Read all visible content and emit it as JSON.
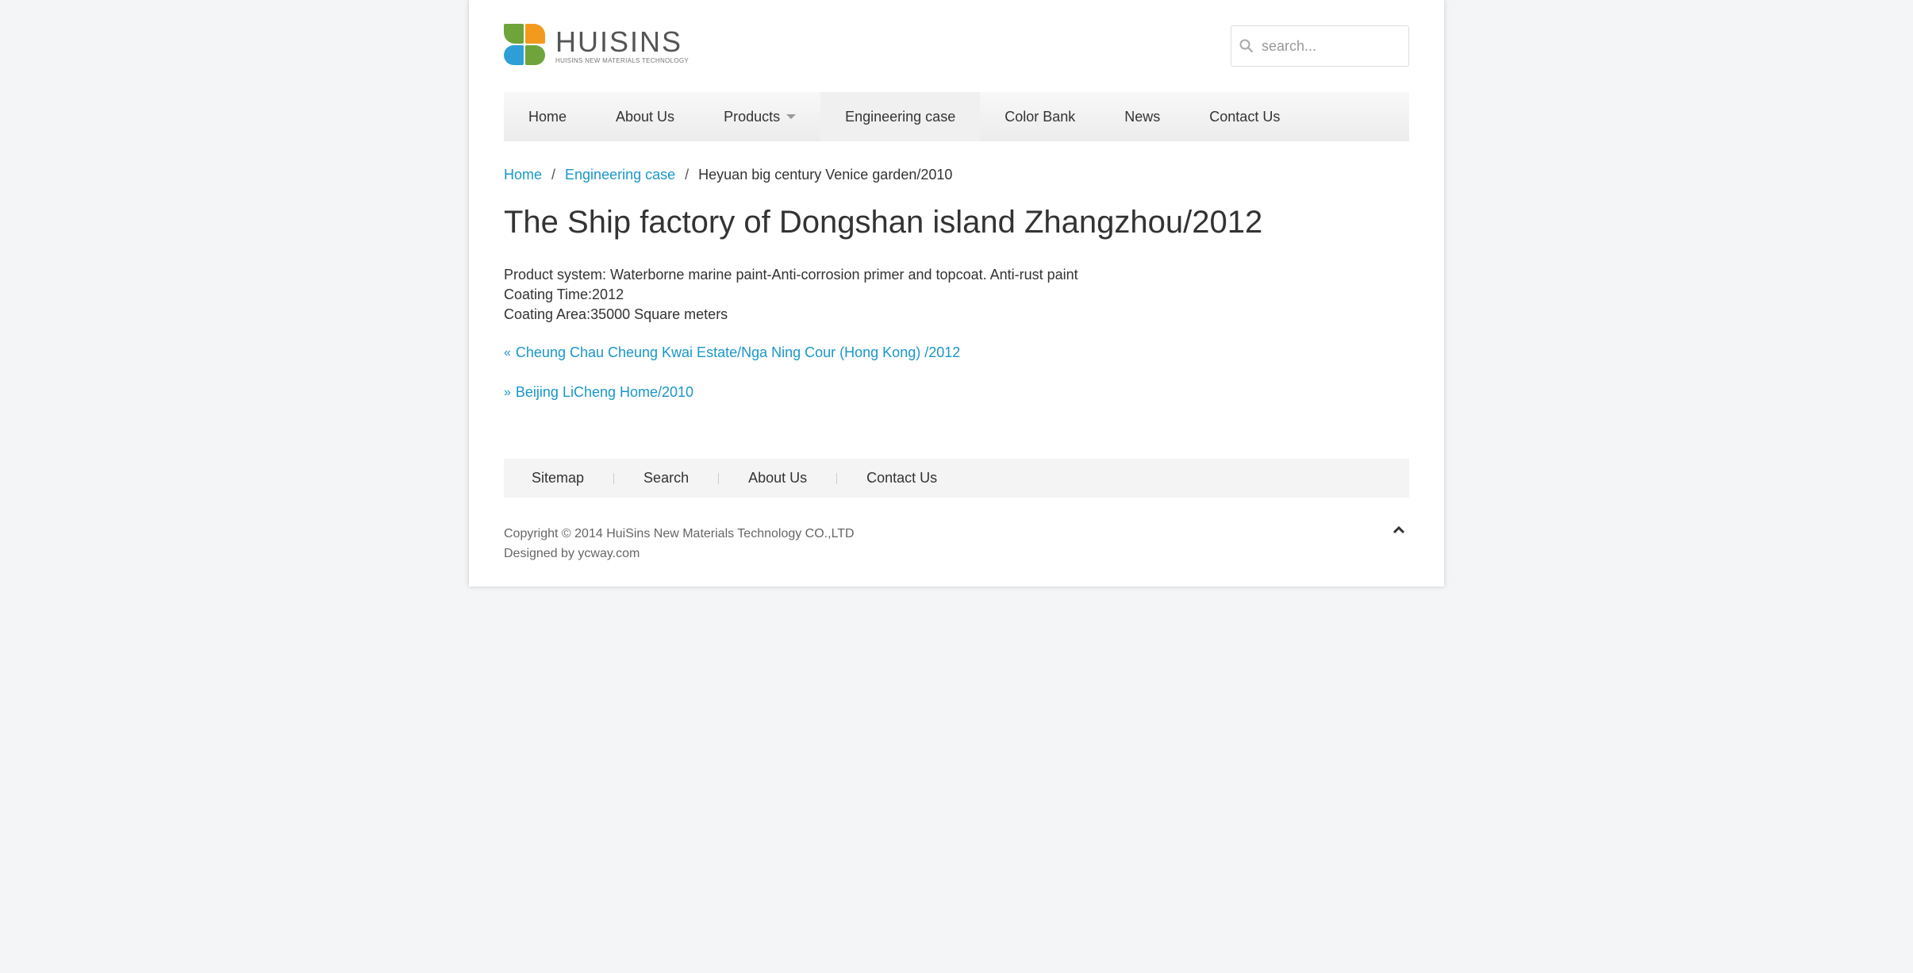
{
  "brand": {
    "name": "HUISINS",
    "tagline": "HUISINS NEW MATERIALS TECHNOLOGY",
    "colors": {
      "green": "#6ea43a",
      "orange": "#f39a1e",
      "blue": "#2d9fd6"
    }
  },
  "search": {
    "placeholder": "search...",
    "value": "",
    "icon": "search-icon"
  },
  "nav": {
    "items": [
      {
        "label": "Home"
      },
      {
        "label": "About Us"
      },
      {
        "label": "Products",
        "has_dropdown": true
      },
      {
        "label": "Engineering case",
        "active": true
      },
      {
        "label": "Color Bank"
      },
      {
        "label": "News"
      },
      {
        "label": "Contact Us"
      }
    ]
  },
  "breadcrumb": {
    "home": "Home",
    "sep1": "/",
    "section": "Engineering case",
    "sep2": "/",
    "current": "Heyuan big century Venice garden/2010"
  },
  "article": {
    "title": "The Ship factory of Dongshan island Zhangzhou/2012",
    "lines": [
      "Product system: Waterborne marine paint-Anti-corrosion primer and topcoat. Anti-rust paint",
      "Coating Time:2012",
      "Coating Area:35000 Square meters"
    ]
  },
  "pager": {
    "prev": {
      "icon": "double-chevron-left-icon",
      "label": "Cheung Chau Cheung Kwai Estate/Nga Ning Cour (Hong Kong) /2012"
    },
    "next": {
      "icon": "double-chevron-right-icon",
      "label": "Beijing LiCheng Home/2010"
    }
  },
  "footer": {
    "links": [
      "Sitemap",
      "Search",
      "About Us",
      "Contact Us"
    ],
    "copyright": "Copyright © 2014 HuiSins New Materials Technology CO.,LTD",
    "designed_by": "Designed by ycway.com",
    "to_top_icon": "chevron-up-icon"
  },
  "colors": {
    "link": "#1a97c9",
    "background": "#f4f5f7",
    "text": "#333333"
  }
}
